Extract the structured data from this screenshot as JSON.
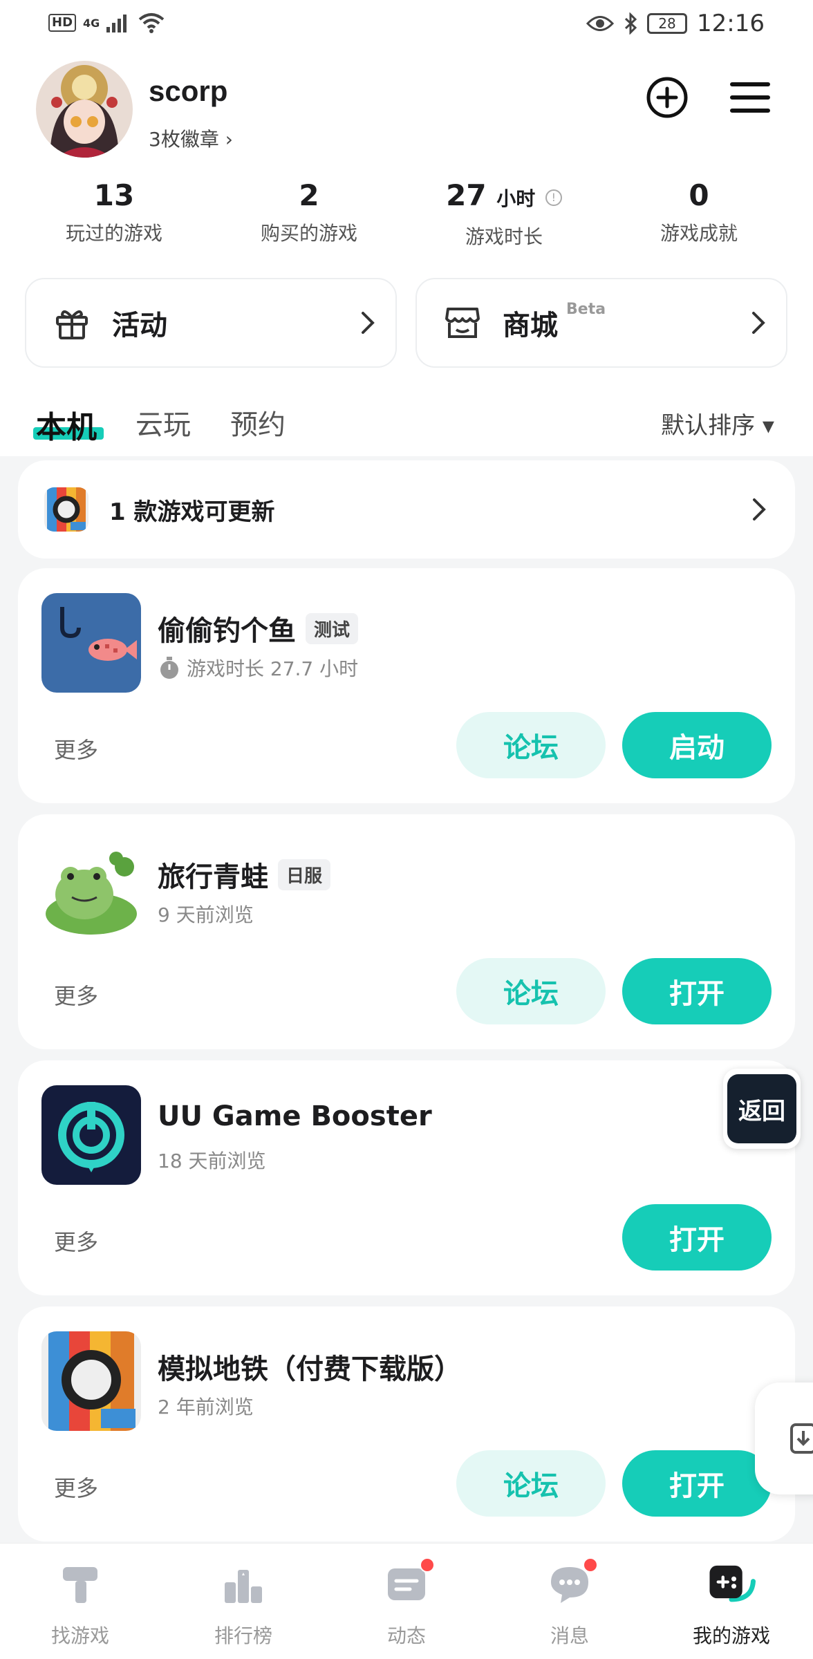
{
  "status_bar": {
    "left_hd": "HD",
    "left_net": "4G",
    "battery": "28",
    "time": "12:16"
  },
  "profile": {
    "username": "scorp",
    "badges": "3枚徽章 ›"
  },
  "stats": [
    {
      "value": "13",
      "unit": "",
      "label": "玩过的游戏"
    },
    {
      "value": "2",
      "unit": "",
      "label": "购买的游戏"
    },
    {
      "value": "27",
      "unit": "小时",
      "label": "游戏时长"
    },
    {
      "value": "0",
      "unit": "",
      "label": "游戏成就"
    }
  ],
  "promos": {
    "activity": "活动",
    "store": "商城",
    "store_badge": "Beta"
  },
  "tabs": {
    "local": "本机",
    "cloud": "云玩",
    "reserve": "预约",
    "sort": "默认排序 ▾"
  },
  "update_row": {
    "text": "1 款游戏可更新"
  },
  "games": [
    {
      "title": "偷偷钓个鱼",
      "tag": "测试",
      "sub": "游戏时长 27.7 小时",
      "more": "更多",
      "forum": "论坛",
      "action": "启动"
    },
    {
      "title": "旅行青蛙",
      "tag": "日服",
      "sub": "9 天前浏览",
      "more": "更多",
      "forum": "论坛",
      "action": "打开"
    },
    {
      "title": "UU Game Booster",
      "tag": "",
      "sub": "18 天前浏览",
      "more": "更多",
      "forum": "",
      "action": "打开"
    },
    {
      "title": "模拟地铁（付费下载版）",
      "tag": "",
      "sub": "2 年前浏览",
      "more": "更多",
      "forum": "论坛",
      "action": "打开"
    }
  ],
  "float_back": "返回",
  "nav": [
    {
      "label": "找游戏"
    },
    {
      "label": "排行榜"
    },
    {
      "label": "动态"
    },
    {
      "label": "消息"
    },
    {
      "label": "我的游戏"
    }
  ],
  "colors": {
    "accent": "#16cdb8",
    "accent_light": "#e4f8f5",
    "badge_red": "#ff4a4a"
  }
}
